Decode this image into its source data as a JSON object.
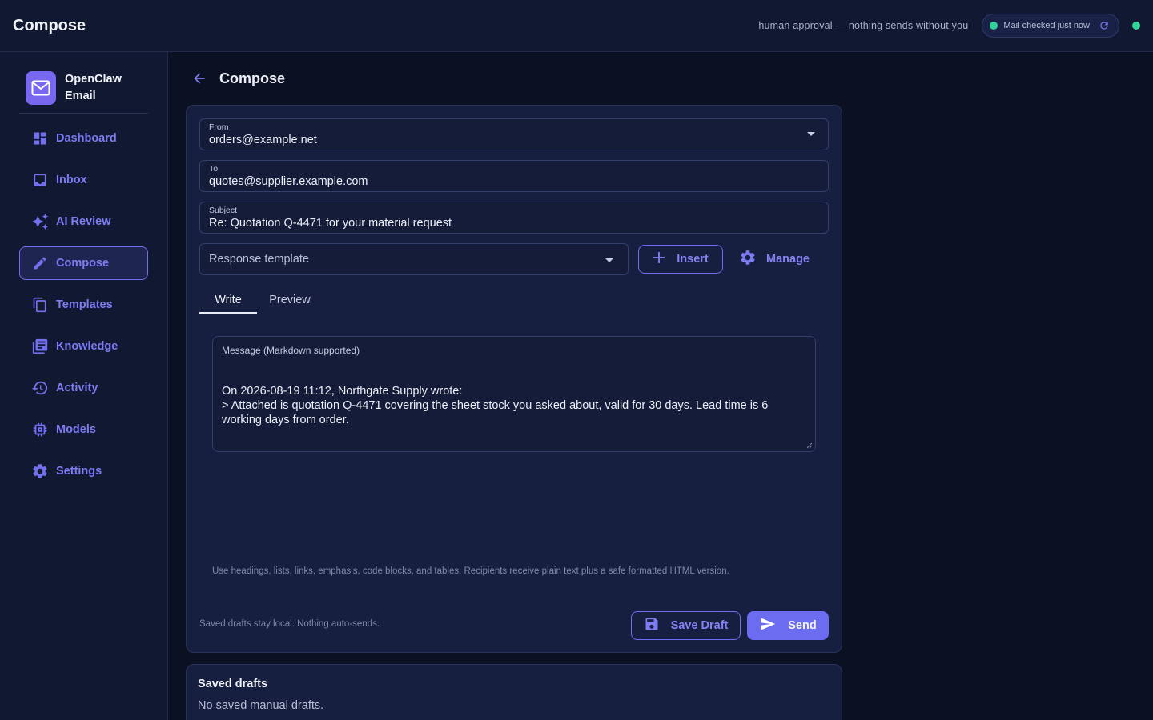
{
  "header": {
    "title": "Compose",
    "approval_text": "human approval — nothing sends without you",
    "mail_status": "Mail checked just now"
  },
  "sidebar": {
    "brand": "OpenClaw Email",
    "items": [
      {
        "label": "Dashboard",
        "icon": "dashboard-icon"
      },
      {
        "label": "Inbox",
        "icon": "inbox-icon"
      },
      {
        "label": "AI Review",
        "icon": "sparkle-icon"
      },
      {
        "label": "Compose",
        "icon": "pencil-icon",
        "active": true
      },
      {
        "label": "Templates",
        "icon": "copy-icon"
      },
      {
        "label": "Knowledge",
        "icon": "library-icon"
      },
      {
        "label": "Activity",
        "icon": "history-icon"
      },
      {
        "label": "Models",
        "icon": "chip-icon"
      },
      {
        "label": "Settings",
        "icon": "gear-icon"
      }
    ]
  },
  "page": {
    "title": "Compose"
  },
  "form": {
    "from_label": "From",
    "from_value": "orders@example.net",
    "to_label": "To",
    "to_value": "quotes@supplier.example.com",
    "subject_label": "Subject",
    "subject_value": "Re: Quotation Q-4471 for your material request",
    "template_placeholder": "Response template",
    "insert_label": "Insert",
    "manage_label": "Manage",
    "tabs": [
      "Write",
      "Preview"
    ],
    "message_label": "Message (Markdown supported)",
    "message_line1": "On 2026-08-19 11:12, Northgate Supply wrote:",
    "message_line2": "> Attached is quotation Q-4471 covering the sheet stock you asked about, valid for 30 days. Lead time is 6 working days from order.",
    "hint": "Use headings, lists, links, emphasis, code blocks, and tables. Recipients receive plain text plus a safe formatted HTML version.",
    "footer_note": "Saved drafts stay local. Nothing auto-sends.",
    "save_draft_label": "Save Draft",
    "send_label": "Send"
  },
  "drafts": {
    "title": "Saved drafts",
    "empty": "No saved manual drafts."
  },
  "colors": {
    "accent": "#6c6cf0",
    "status_ok": "#34d399",
    "background": "#0b1022"
  }
}
